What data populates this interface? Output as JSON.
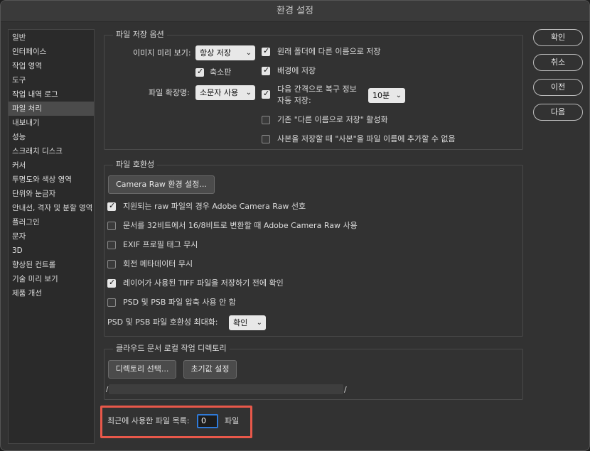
{
  "window": {
    "title": "환경 설정"
  },
  "sidebar": {
    "items": [
      {
        "label": "일반"
      },
      {
        "label": "인터페이스"
      },
      {
        "label": "작업 영역"
      },
      {
        "label": "도구"
      },
      {
        "label": "작업 내역 로그"
      },
      {
        "label": "파일 처리",
        "selected": true
      },
      {
        "label": "내보내기"
      },
      {
        "label": "성능"
      },
      {
        "label": "스크래치 디스크"
      },
      {
        "label": "커서"
      },
      {
        "label": "투명도와 색상 영역"
      },
      {
        "label": "단위와 눈금자"
      },
      {
        "label": "안내선, 격자 및 분할 영역"
      },
      {
        "label": "플러그인"
      },
      {
        "label": "문자"
      },
      {
        "label": "3D"
      },
      {
        "label": "향상된 컨트롤"
      },
      {
        "label": "기술 미리 보기"
      },
      {
        "label": "제품 개선"
      }
    ]
  },
  "file_save": {
    "legend": "파일 저장 옵션",
    "image_preview_label": "이미지 미리 보기:",
    "image_preview_value": "항상 저장",
    "thumbnail_label": "축소판",
    "thumbnail_checked": true,
    "file_ext_label": "파일 확장명:",
    "file_ext_value": "소문자 사용",
    "save_original_folder_label": "원래 폴더에 다른 이름으로 저장",
    "save_original_folder_checked": true,
    "save_background_label": "배경에 저장",
    "save_background_checked": true,
    "autosave_label_line1": "다음 간격으로 복구 정보",
    "autosave_label_line2": "자동 저장:",
    "autosave_checked": true,
    "autosave_interval": "10분",
    "legacy_save_as_label": "기존 \"다른 이름으로 저장\" 활성화",
    "legacy_save_as_checked": false,
    "no_copy_suffix_label": "사본을 저장할 때 \"사본\"을 파일 이름에 추가할 수 없음",
    "no_copy_suffix_checked": false
  },
  "compat": {
    "legend": "파일 호환성",
    "camera_raw_button": "Camera Raw 환경 설정...",
    "opt1_label": "지원되는 raw 파일의 경우 Adobe Camera Raw 선호",
    "opt1_checked": true,
    "opt2_label": "문서를 32비트에서 16/8비트로 변환할 때 Adobe Camera Raw 사용",
    "opt2_checked": false,
    "opt3_label": "EXIF 프로필 태그 무시",
    "opt3_checked": false,
    "opt4_label": "회전 메타데이터 무시",
    "opt4_checked": false,
    "opt5_label": "레이어가 사용된 TIFF 파일을 저장하기 전에 확인",
    "opt5_checked": true,
    "opt6_label": "PSD 및 PSB 파일 압축 사용 안 함",
    "opt6_checked": false,
    "maximize_label": "PSD 및 PSB 파일 호환성 최대화:",
    "maximize_value": "확인"
  },
  "cloud": {
    "legend": "클라우드 문서 로컬 작업 디렉토리",
    "choose_dir_button": "디렉토리 선택...",
    "reset_button": "초기값 설정",
    "path_suffix": "/"
  },
  "recent": {
    "label": "최근에 사용한 파일 목록:",
    "value": "0",
    "unit": "파일"
  },
  "actions": {
    "ok": "확인",
    "cancel": "취소",
    "prev": "이전",
    "next": "다음"
  },
  "colors": {
    "highlight": "#e8584a",
    "focus": "#2f7ad8"
  }
}
